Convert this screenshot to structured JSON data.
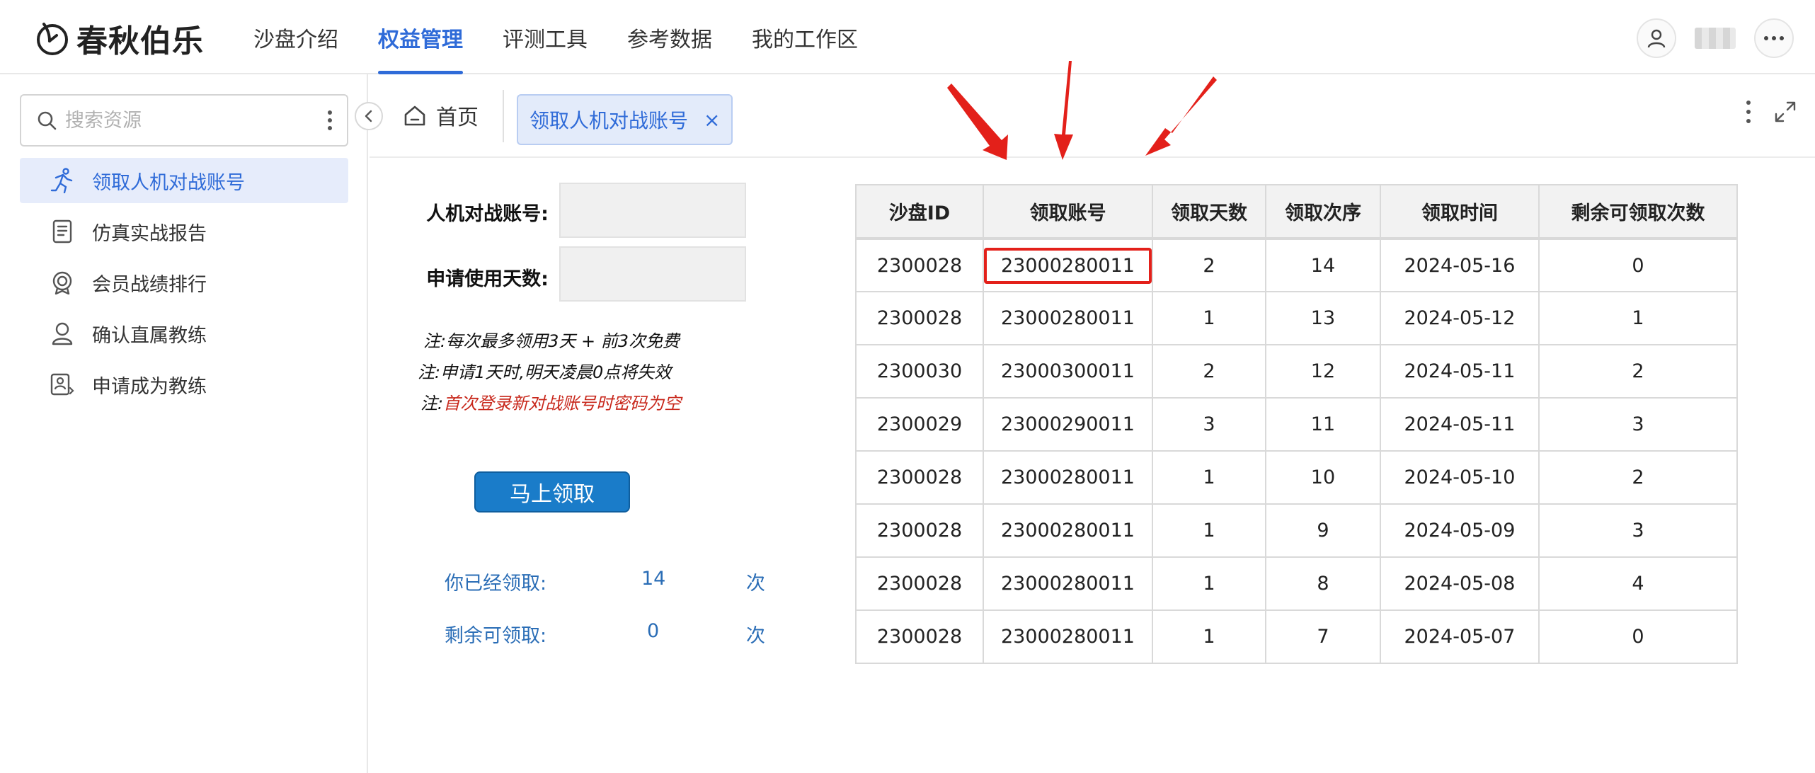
{
  "brand": {
    "name": "春秋伯乐"
  },
  "nav": [
    {
      "label": "沙盘介绍"
    },
    {
      "label": "权益管理"
    },
    {
      "label": "评测工具"
    },
    {
      "label": "参考数据"
    },
    {
      "label": "我的工作区"
    }
  ],
  "sidebar": {
    "search_placeholder": "搜索资源",
    "items": [
      {
        "label": "领取人机对战账号",
        "icon": "running-person-icon"
      },
      {
        "label": "仿真实战报告",
        "icon": "report-icon"
      },
      {
        "label": "会员战绩排行",
        "icon": "medal-icon"
      },
      {
        "label": "确认直属教练",
        "icon": "user-icon"
      },
      {
        "label": "申请成为教练",
        "icon": "id-card-icon"
      }
    ]
  },
  "tabs": {
    "home": "首页",
    "current": "领取人机对战账号",
    "close": "×"
  },
  "form": {
    "account_label": "人机对战账号:",
    "days_label": "申请使用天数:",
    "note1": "注:每次最多领用3天 + 前3次免费",
    "note2": "注:申请1天时,明天凌晨0点将失效",
    "note3_prefix": "注:",
    "note3_red": "首次登录新对战账号时密码为空",
    "button": "马上领取",
    "claimed_label": "你已经领取:",
    "claimed_value": "14",
    "claimed_unit": "次",
    "remaining_label": "剩余可领取:",
    "remaining_value": "0",
    "remaining_unit": "次"
  },
  "table": {
    "headers": [
      "沙盘ID",
      "领取账号",
      "领取天数",
      "领取次序",
      "领取时间",
      "剩余可领取次数"
    ],
    "rows": [
      [
        "2300028",
        "23000280011",
        "2",
        "14",
        "2024-05-16",
        "0"
      ],
      [
        "2300028",
        "23000280011",
        "1",
        "13",
        "2024-05-12",
        "1"
      ],
      [
        "2300030",
        "23000300011",
        "2",
        "12",
        "2024-05-11",
        "2"
      ],
      [
        "2300029",
        "23000290011",
        "3",
        "11",
        "2024-05-11",
        "3"
      ],
      [
        "2300028",
        "23000280011",
        "1",
        "10",
        "2024-05-10",
        "2"
      ],
      [
        "2300028",
        "23000280011",
        "1",
        "9",
        "2024-05-09",
        "3"
      ],
      [
        "2300028",
        "23000280011",
        "1",
        "8",
        "2024-05-08",
        "4"
      ],
      [
        "2300028",
        "23000280011",
        "1",
        "7",
        "2024-05-07",
        "0"
      ]
    ]
  },
  "colors": {
    "accent": "#2f6bd8",
    "annotation": "#e3201a",
    "button": "#1a7cc9"
  }
}
